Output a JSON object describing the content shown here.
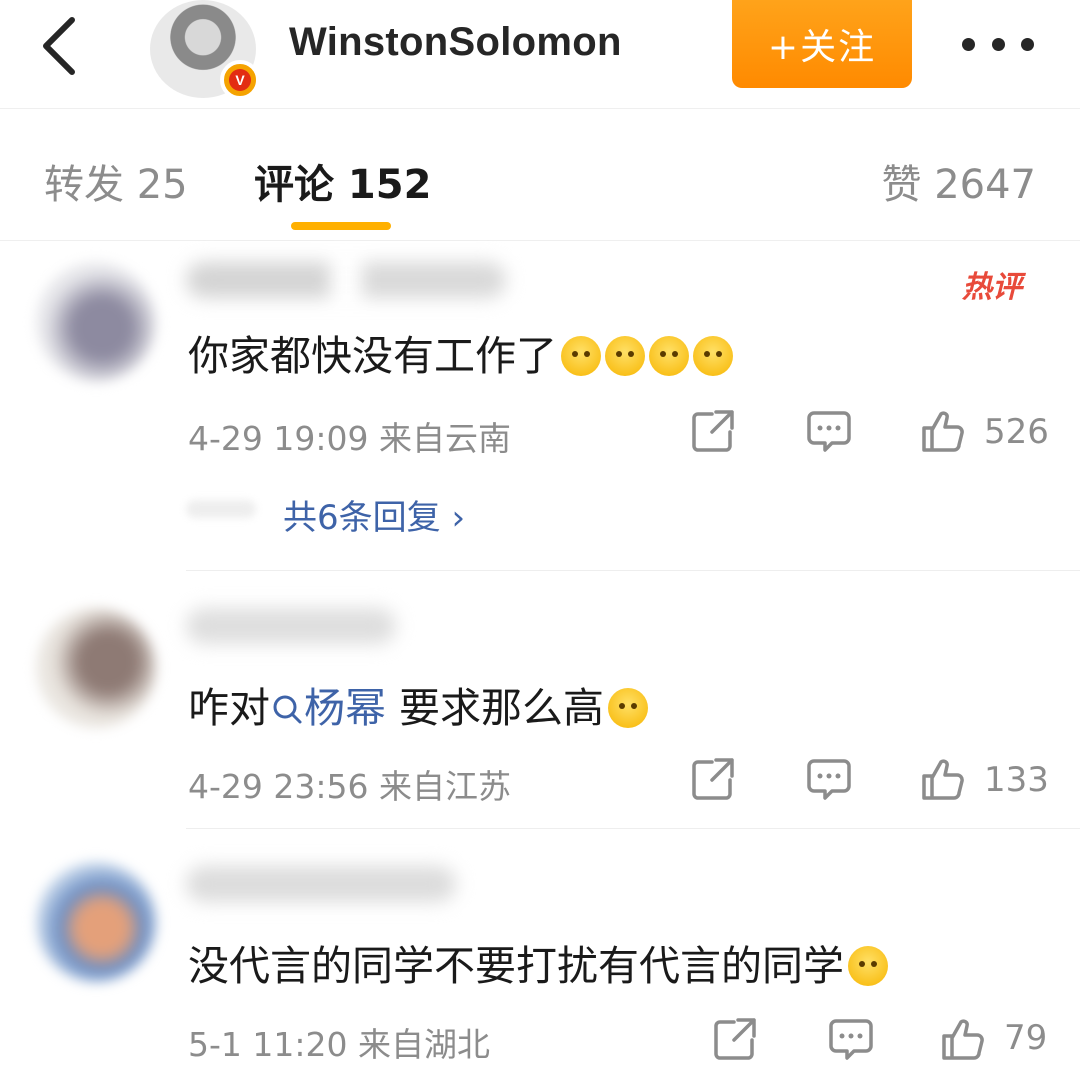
{
  "header": {
    "username": "WinstonSolomon",
    "verified_badge": "V",
    "follow_label": "+关注",
    "icons": [
      "back-arrow-icon",
      "verified-badge-icon",
      "more-icon"
    ]
  },
  "tabs": {
    "repost": "转发 25",
    "comment": "评论 152",
    "like": "赞 2647",
    "active": "comment",
    "accent_color": "#ffb000"
  },
  "comments": [
    {
      "badge": "热评",
      "text": "你家都快没有工作了",
      "emoji_count": 4,
      "meta": "4-29 19:09  来自云南",
      "likes": "526",
      "replies_label": "共6条回复 ›"
    },
    {
      "text_before": "咋对",
      "mention": "杨幂",
      "text_after": " 要求那么高",
      "meta": "4-29 23:56  来自江苏",
      "likes": "133"
    },
    {
      "text": "没代言的同学不要打扰有代言的同学",
      "meta": "5-1 11:20  来自湖北",
      "likes": "79"
    }
  ],
  "colors": {
    "follow_button": "#ff9a0d",
    "link": "#3e63a8",
    "hot_badge": "#e84a3a",
    "secondary_text": "#8c8c8c"
  }
}
